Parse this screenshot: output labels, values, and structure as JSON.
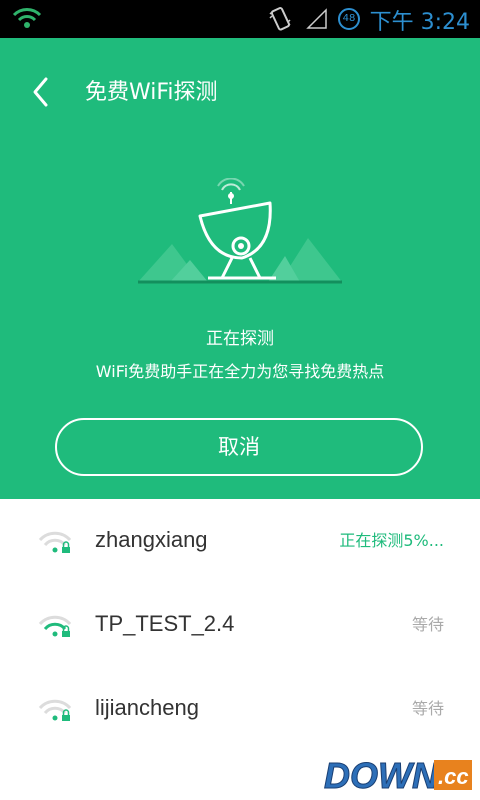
{
  "status_bar": {
    "time": "下午 3:24",
    "battery": "48"
  },
  "header": {
    "title": "免费WiFi探测",
    "status_title": "正在探测",
    "status_desc": "WiFi免费助手正在全力为您寻找免费热点",
    "cancel_label": "取消"
  },
  "networks": [
    {
      "ssid": "zhangxiang",
      "state": "正在探测5%..."
    },
    {
      "ssid": "TP_TEST_2.4",
      "state": "等待"
    },
    {
      "ssid": "lijiancheng",
      "state": "等待"
    }
  ],
  "watermark": {
    "text": "DOWN.cc"
  },
  "colors": {
    "accent": "#1fbb7c",
    "clock": "#2d8fd0"
  }
}
